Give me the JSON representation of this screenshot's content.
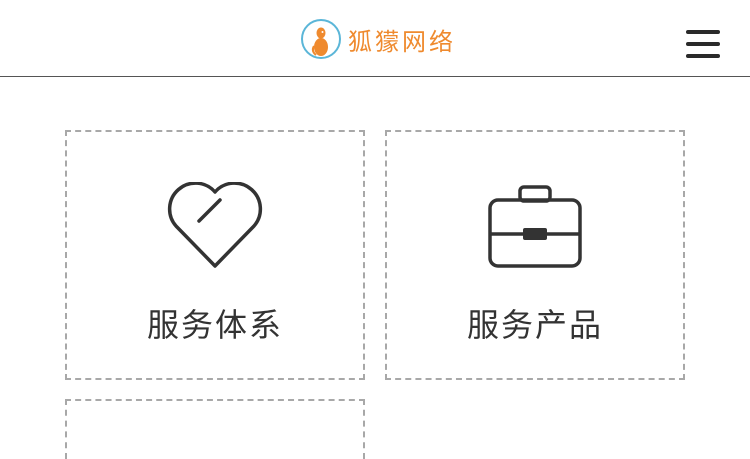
{
  "header": {
    "logo_text": "狐獴网络",
    "logo_icon": "meerkat-logo-icon",
    "menu_icon": "hamburger-menu-icon"
  },
  "colors": {
    "brand_orange": "#ef8a2e",
    "logo_ring": "#5bb6d8",
    "text": "#333333",
    "card_border": "#a8a8a8"
  },
  "cards": [
    {
      "label": "服务体系",
      "icon": "heart-icon"
    },
    {
      "label": "服务产品",
      "icon": "briefcase-icon"
    },
    {
      "label": "",
      "icon": ""
    }
  ]
}
